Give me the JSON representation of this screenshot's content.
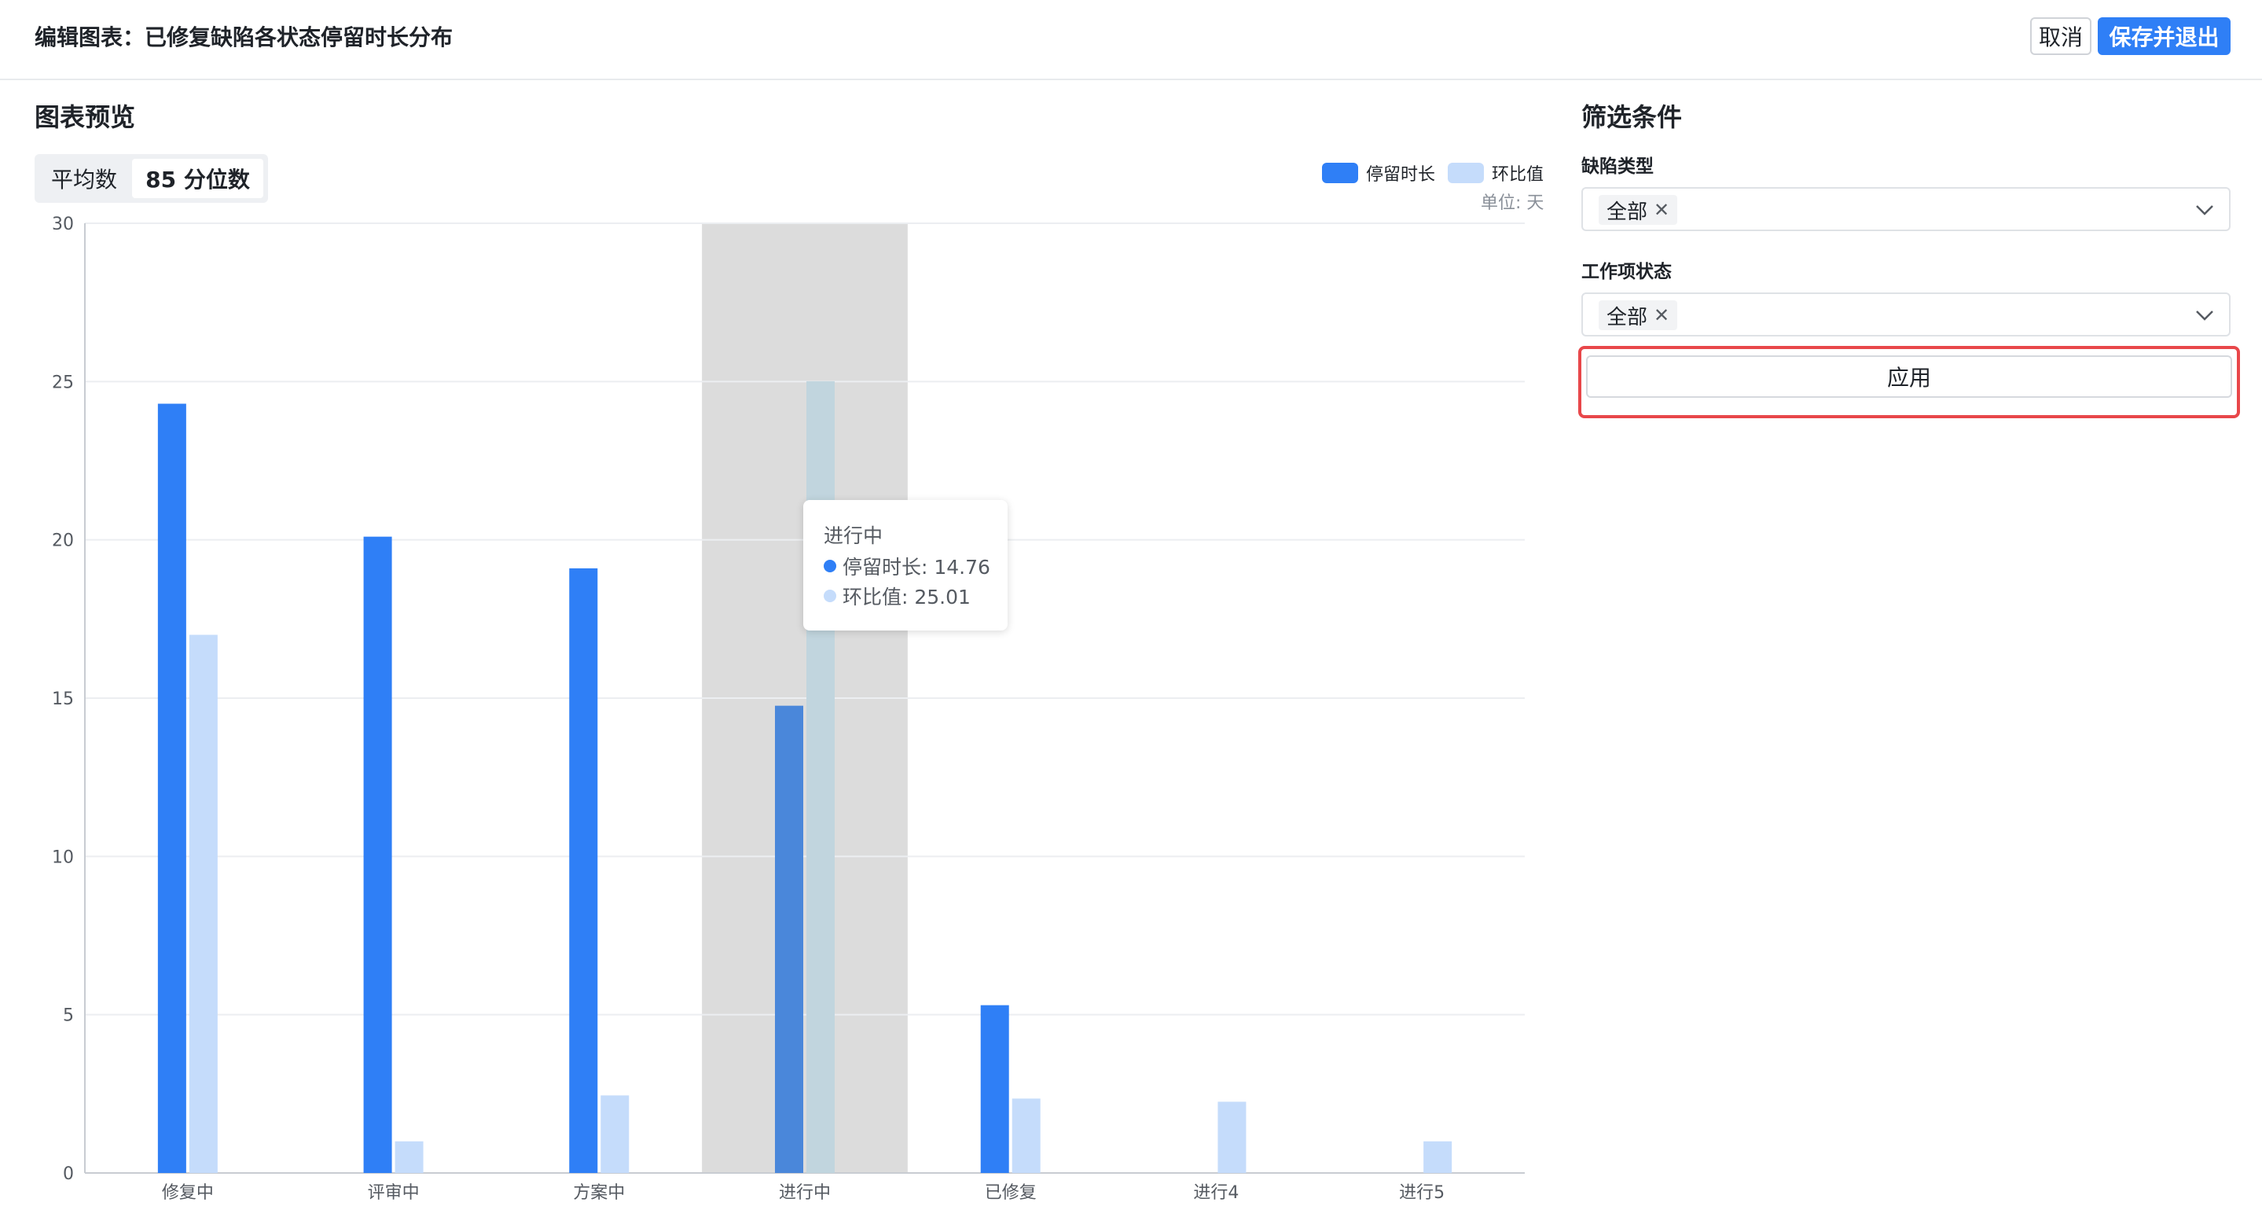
{
  "header": {
    "title": "编辑图表：已修复缺陷各状态停留时长分布",
    "cancel_label": "取消",
    "save_label": "保存并退出"
  },
  "preview": {
    "title": "图表预览",
    "metric_options": [
      "平均数",
      "85 分位数"
    ],
    "selected_metric": "85 分位数",
    "legend": [
      "停留时长",
      "环比值"
    ],
    "unit": "单位: 天"
  },
  "colors": {
    "primary": "#2f7ff6",
    "secondary": "#c5dcfb",
    "highlight_border": "#e8474a",
    "hover_band": "#dcdcdc"
  },
  "chart_data": {
    "type": "bar",
    "categories": [
      "修复中",
      "评审中",
      "方案中",
      "进行中",
      "已修复",
      "进行4",
      "进行5"
    ],
    "series": [
      {
        "name": "停留时长",
        "values": [
          24.3,
          20.1,
          19.1,
          14.76,
          5.3,
          0,
          0
        ]
      },
      {
        "name": "环比值",
        "values": [
          17.0,
          1.0,
          2.45,
          25.01,
          2.35,
          2.25,
          1.0
        ]
      }
    ],
    "ylim": [
      0,
      30
    ],
    "yticks": [
      0,
      5,
      10,
      15,
      20,
      25,
      30
    ],
    "grid": true,
    "legend_position": "top-right",
    "hovered_category": "进行中"
  },
  "tooltip": {
    "title": "进行中",
    "row1": "停留时长: 14.76",
    "row2": "环比值: 25.01"
  },
  "filters": {
    "title": "筛选条件",
    "defect_type": {
      "label": "缺陷类型",
      "tag": "全部"
    },
    "work_item_status": {
      "label": "工作项状态",
      "tag": "全部"
    },
    "apply_label": "应用"
  },
  "icons": {
    "tag_close": "close-icon",
    "dropdown": "chevron-down-icon"
  }
}
